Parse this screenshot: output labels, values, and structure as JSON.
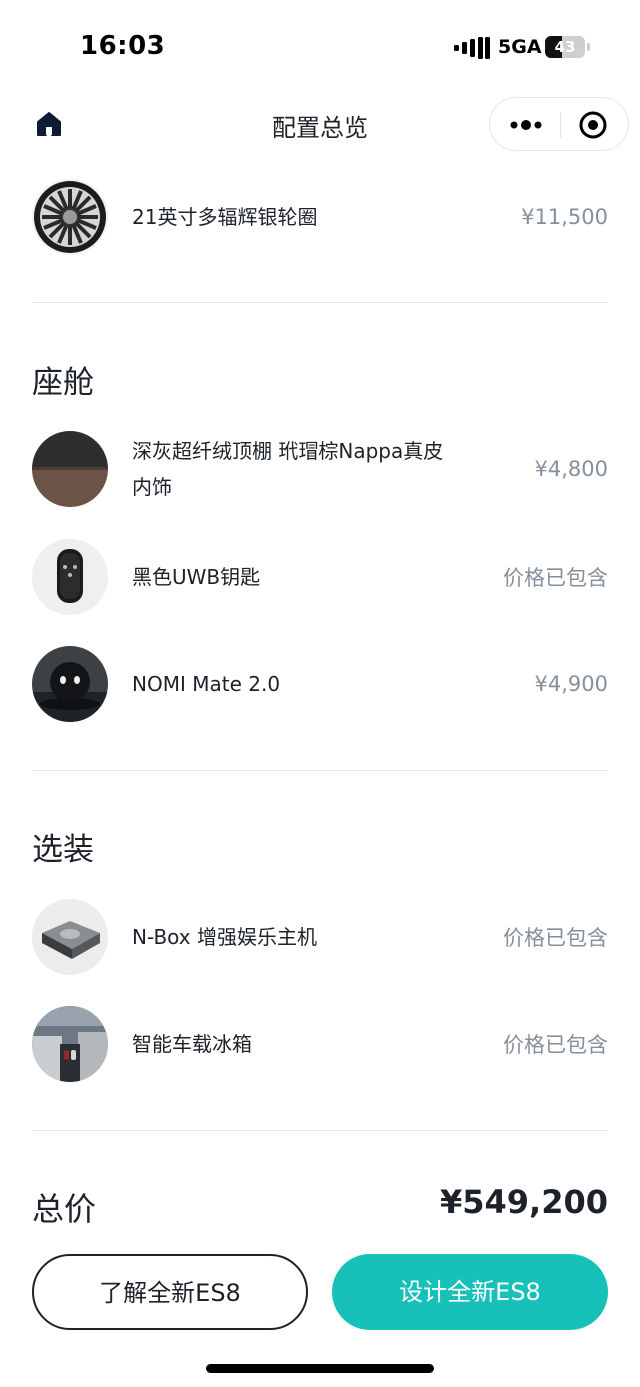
{
  "status_bar": {
    "time": "16:03",
    "network": "5GA",
    "battery": "43",
    "battery_level": 0.43
  },
  "nav": {
    "title": "配置总览",
    "home_icon": "home-icon",
    "more_icon": "more-dots-icon",
    "close_icon": "target-circle-icon"
  },
  "wheels": {
    "name": "21英寸多辐辉银轮圈",
    "price": "¥11,500"
  },
  "cabin": {
    "title": "座舱",
    "items": [
      {
        "name": "深灰超纤绒顶棚 玳瑁棕Nappa真皮内饰",
        "price": "¥4,800"
      },
      {
        "name": "黑色UWB钥匙",
        "price": "价格已包含"
      },
      {
        "name": "NOMI Mate 2.0",
        "price": "¥4,900"
      }
    ]
  },
  "options": {
    "title": "选装",
    "items": [
      {
        "name": "N-Box 增强娱乐主机",
        "price": "价格已包含"
      },
      {
        "name": "智能车载冰箱",
        "price": "价格已包含"
      }
    ]
  },
  "total": {
    "label": "总价",
    "value": "¥549,200"
  },
  "buttons": {
    "learn": "了解全新ES8",
    "design": "设计全新ES8"
  },
  "colors": {
    "accent": "#17c0b9",
    "text": "#1d2129",
    "muted": "#86909c"
  }
}
